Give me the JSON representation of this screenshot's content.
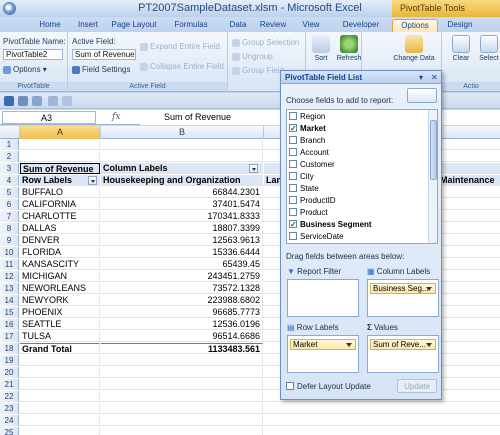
{
  "window": {
    "title": "PT2007SampleDataset.xlsm - Microsoft Excel",
    "context_tab": "PivotTable Tools"
  },
  "tabs": [
    "Home",
    "Insert",
    "Page Layout",
    "Formulas",
    "Data",
    "Review",
    "View",
    "Developer",
    "Options",
    "Design"
  ],
  "active_tab": "Options",
  "ribbon": {
    "pivottable_group": {
      "name_label": "PivotTable Name:",
      "name_value": "PivotTable2",
      "options_label": "Options",
      "group_label": "PivotTable"
    },
    "active_field_group": {
      "field_label": "Active Field:",
      "field_value": "Sum of Revenue",
      "field_settings": "Field Settings",
      "expand": "Expand Entire Field",
      "collapse": "Collapse Entire Field",
      "group_label": "Active Field"
    },
    "group_group": {
      "group_selection": "Group Selection",
      "ungroup": "Ungroup",
      "group_field": "Group Field"
    },
    "sort_label": "Sort",
    "refresh_label": "Refresh",
    "change_data_label": "Change Data",
    "clear_label": "Clear",
    "select_label": "Select",
    "action_label": "Actio"
  },
  "formula_bar": {
    "cell_ref": "A3",
    "fx": "fx",
    "content": "Sum of Revenue"
  },
  "columns": [
    "A",
    "B"
  ],
  "sheet": {
    "rows": [
      {
        "n": "1",
        "a": "",
        "b": "",
        "c": ""
      },
      {
        "n": "2",
        "a": "",
        "b": "",
        "c": ""
      },
      {
        "n": "3",
        "a": "Sum of Revenue",
        "b": "Column Labels",
        "c": ""
      },
      {
        "n": "4",
        "a": "Row Labels",
        "b": "Housekeeping and Organization",
        "c": "Lan"
      },
      {
        "n": "5",
        "a": "BUFFALO",
        "b": "66844.2301",
        "c": ""
      },
      {
        "n": "6",
        "a": "CALIFORNIA",
        "b": "37401.5474",
        "c": ""
      },
      {
        "n": "7",
        "a": "CHARLOTTE",
        "b": "170341.8333",
        "c": ""
      },
      {
        "n": "8",
        "a": "DALLAS",
        "b": "18807.3399",
        "c": ""
      },
      {
        "n": "9",
        "a": "DENVER",
        "b": "12563.9613",
        "c": ""
      },
      {
        "n": "10",
        "a": "FLORIDA",
        "b": "15336.6444",
        "c": ""
      },
      {
        "n": "11",
        "a": "KANSASCITY",
        "b": "65439.45",
        "c": ""
      },
      {
        "n": "12",
        "a": "MICHIGAN",
        "b": "243451.2759",
        "c": ""
      },
      {
        "n": "13",
        "a": "NEWORLEANS",
        "b": "73572.1328",
        "c": ""
      },
      {
        "n": "14",
        "a": "NEWYORK",
        "b": "223988.6802",
        "c": ""
      },
      {
        "n": "15",
        "a": "PHOENIX",
        "b": "96685.7773",
        "c": ""
      },
      {
        "n": "16",
        "a": "SEATTLE",
        "b": "12536.0196",
        "c": ""
      },
      {
        "n": "17",
        "a": "TULSA",
        "b": "96514.6686",
        "c": ""
      },
      {
        "n": "18",
        "a": "Grand Total",
        "b": "1133483.561",
        "c": ""
      },
      {
        "n": "19",
        "a": "",
        "b": "",
        "c": ""
      },
      {
        "n": "20",
        "a": "",
        "b": "",
        "c": ""
      },
      {
        "n": "21",
        "a": "",
        "b": "",
        "c": ""
      },
      {
        "n": "22",
        "a": "",
        "b": "",
        "c": ""
      },
      {
        "n": "23",
        "a": "",
        "b": "",
        "c": ""
      },
      {
        "n": "24",
        "a": "",
        "b": "",
        "c": ""
      },
      {
        "n": "25",
        "a": "",
        "b": "",
        "c": ""
      }
    ],
    "far_right_header": "Maintenance"
  },
  "field_list": {
    "title": "PivotTable Field List",
    "choose_label": "Choose fields to add to report:",
    "fields": [
      {
        "label": "Region",
        "checked": false
      },
      {
        "label": "Market",
        "checked": true
      },
      {
        "label": "Branch",
        "checked": false
      },
      {
        "label": "Account",
        "checked": false
      },
      {
        "label": "Customer",
        "checked": false
      },
      {
        "label": "City",
        "checked": false
      },
      {
        "label": "State",
        "checked": false
      },
      {
        "label": "ProductID",
        "checked": false
      },
      {
        "label": "Product",
        "checked": false
      },
      {
        "label": "Business Segment",
        "checked": true
      },
      {
        "label": "ServiceDate",
        "checked": false
      }
    ],
    "drag_label": "Drag fields between areas below:",
    "report_filter": "Report Filter",
    "column_labels": "Column Labels",
    "row_labels": "Row Labels",
    "values": "Values",
    "column_chip": "Business Seg...",
    "row_chip": "Market",
    "values_chip": "Sum of Reve...",
    "defer_label": "Defer Layout Update",
    "update_label": "Update"
  },
  "colors": {
    "accent": "#4f81bd",
    "context_tab": "#e9b53a",
    "check": "#1f7a1f"
  }
}
